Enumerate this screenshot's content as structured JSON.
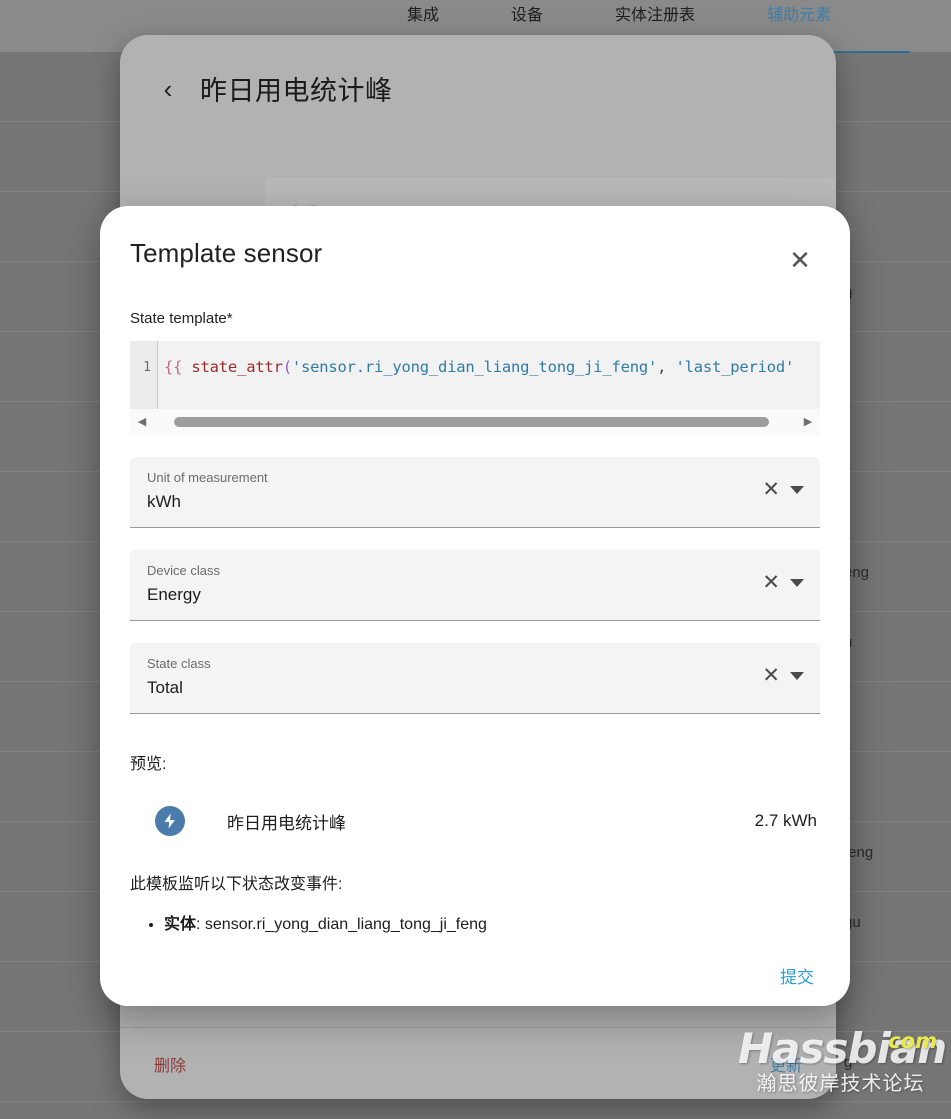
{
  "background": {
    "tabs": [
      {
        "label": "集成",
        "active": false
      },
      {
        "label": "设备",
        "active": false
      },
      {
        "label": "实体注册表",
        "active": false
      },
      {
        "label": "辅助元素",
        "active": true
      }
    ],
    "row_fragments": [
      "",
      "",
      "",
      "g",
      "",
      "",
      "",
      "eng",
      "u",
      "",
      "",
      "feng",
      "gu",
      "",
      "g"
    ],
    "dialog": {
      "back_icon": "chevron-left-icon",
      "title": "昨日用电统计峰",
      "name_field_label": "名称",
      "delete_label": "删除",
      "update_label": "更新"
    }
  },
  "modal": {
    "title": "Template sensor",
    "close_icon": "close-icon",
    "state_template_label": "State template*",
    "code": {
      "line_number": "1",
      "tokens": [
        {
          "text": "{{",
          "type": "brace"
        },
        {
          "text": " ",
          "type": "plain"
        },
        {
          "text": "state_attr",
          "type": "fn"
        },
        {
          "text": "(",
          "type": "paren"
        },
        {
          "text": "'sensor.ri_yong_dian_liang_tong_ji_feng'",
          "type": "str"
        },
        {
          "text": ",",
          "type": "comma"
        },
        {
          "text": " ",
          "type": "plain"
        },
        {
          "text": "'last_period'",
          "type": "str"
        }
      ],
      "full_text": "{{ state_attr('sensor.ri_yong_dian_liang_tong_ji_feng', 'last_period'",
      "scroll_left_arrow": "triangle-left-icon",
      "scroll_right_arrow": "triangle-right-icon"
    },
    "fields": [
      {
        "label": "Unit of measurement",
        "value": "kWh",
        "clear_icon": "clear-icon",
        "caret_icon": "chevron-down-icon"
      },
      {
        "label": "Device class",
        "value": "Energy",
        "clear_icon": "clear-icon",
        "caret_icon": "chevron-down-icon"
      },
      {
        "label": "State class",
        "value": "Total",
        "clear_icon": "clear-icon",
        "caret_icon": "chevron-down-icon"
      }
    ],
    "preview": {
      "label": "预览:",
      "icon": "lightning-bolt-icon",
      "icon_color": "#4b7bab",
      "entity_name": "昨日用电统计峰",
      "entity_value": "2.7 kWh"
    },
    "listen": {
      "text": "此模板监听以下状态改变事件:",
      "items": [
        {
          "key": "实体",
          "separator": ": ",
          "value": "sensor.ri_yong_dian_liang_tong_ji_feng"
        }
      ]
    },
    "submit_label": "提交"
  },
  "watermark": {
    "main": "Hassbian",
    "com": "com",
    "sub": "瀚思彼岸技术论坛"
  },
  "colors": {
    "accent_blue": "#2f9fd0",
    "tab_active": "#3d7ea8",
    "delete_red": "#8a3b3b",
    "backdrop": "#767676"
  }
}
